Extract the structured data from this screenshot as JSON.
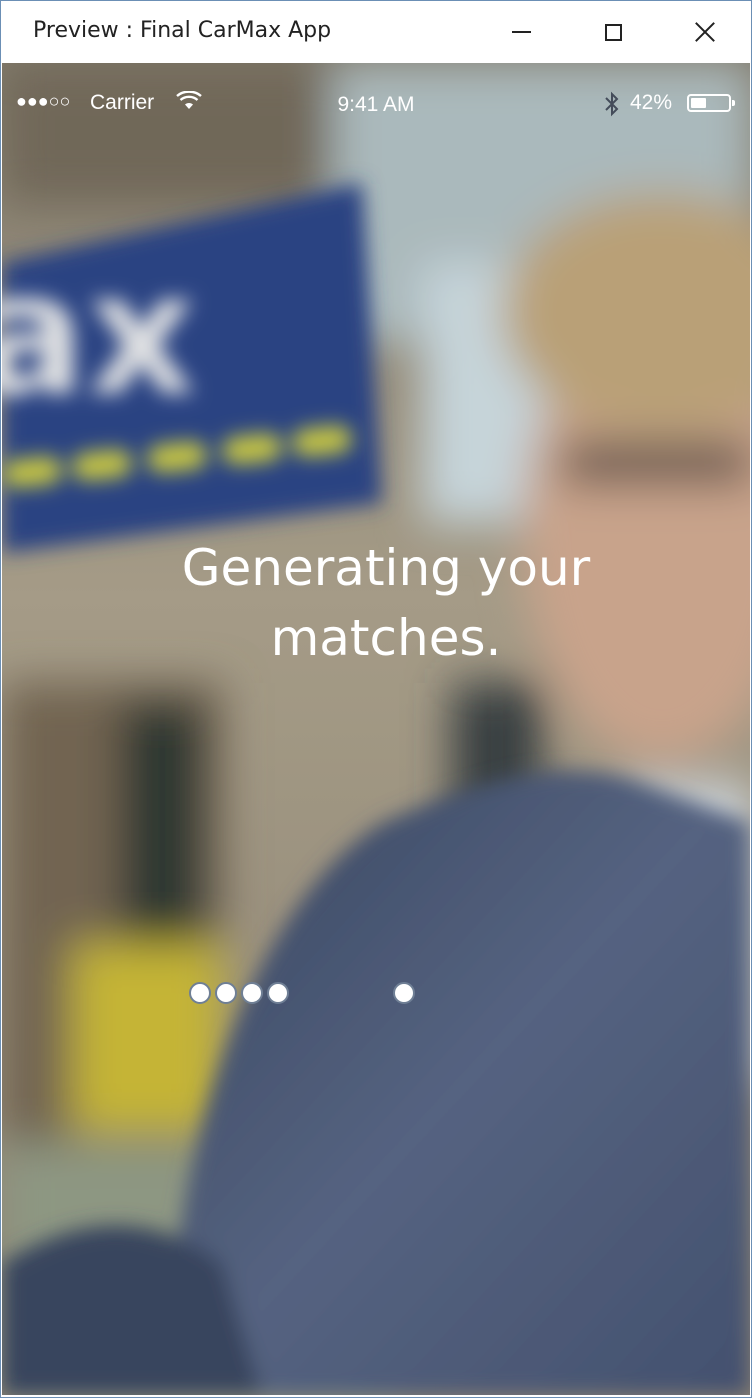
{
  "window": {
    "title": "Preview : Final CarMax App"
  },
  "status_bar": {
    "signal": "●●●○○",
    "carrier": "Carrier",
    "time": "9:41 AM",
    "battery_percent": "42%",
    "battery_level": 0.42,
    "icons": [
      "wifi-icon",
      "bluetooth-icon",
      "battery-icon"
    ]
  },
  "loading": {
    "line1": "Generating your",
    "line2": "matches."
  },
  "background": {
    "sign_text": "ax",
    "accent_blue": "#2e4a8e",
    "accent_yellow": "#d9d84a"
  }
}
